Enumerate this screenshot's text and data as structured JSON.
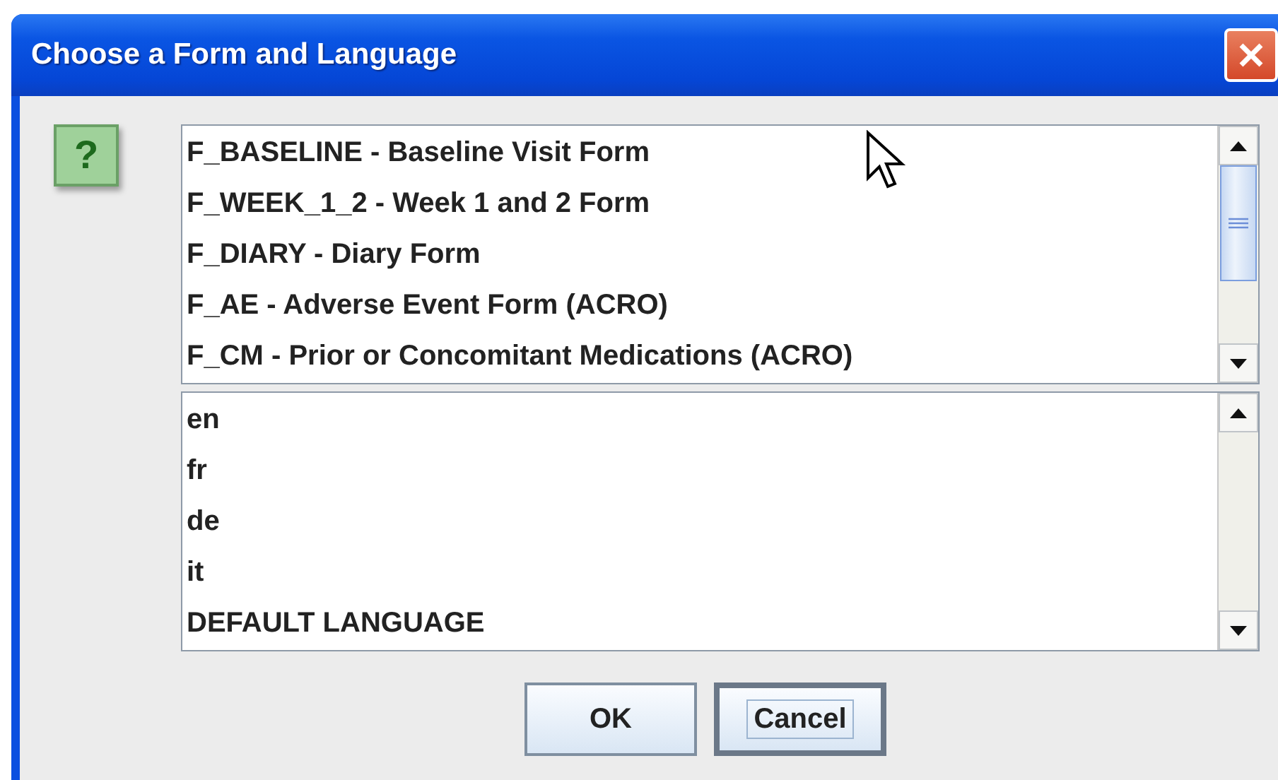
{
  "window": {
    "title": "Choose a Form and Language"
  },
  "icon": {
    "glyph": "?"
  },
  "forms": [
    {
      "label": "F_BASELINE - Baseline Visit Form",
      "selected": false
    },
    {
      "label": "F_WEEK_1_2 - Week 1 and 2 Form",
      "selected": false
    },
    {
      "label": "F_DIARY - Diary Form",
      "selected": false
    },
    {
      "label": "F_AE - Adverse Event Form (ACRO)",
      "selected": false
    },
    {
      "label": "F_CM - Prior or Concomitant Medications (ACRO)",
      "selected": false
    }
  ],
  "languages": [
    {
      "label": "en",
      "selected": false
    },
    {
      "label": "fr",
      "selected": false
    },
    {
      "label": "de",
      "selected": false
    },
    {
      "label": "it",
      "selected": false
    },
    {
      "label": "DEFAULT LANGUAGE",
      "selected": false
    }
  ],
  "buttons": [
    {
      "label": "OK",
      "focused": false
    },
    {
      "label": "Cancel",
      "focused": true
    }
  ]
}
